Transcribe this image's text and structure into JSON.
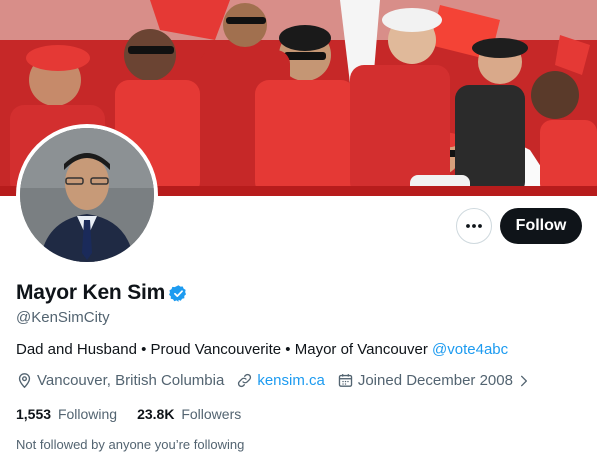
{
  "profile": {
    "display_name": "Mayor Ken Sim",
    "handle": "@KenSimCity",
    "bio_text": "Dad and Husband • Proud Vancouverite • Mayor of Vancouver",
    "bio_mention": "@vote4abc",
    "location": "Vancouver, British Columbia",
    "website": "kensim.ca",
    "joined": "Joined December 2008",
    "following_count": "1,553",
    "following_label": "Following",
    "followers_count": "23.8K",
    "followers_label": "Followers",
    "followed_by_note": "Not followed by anyone you’re following"
  },
  "actions": {
    "follow_label": "Follow",
    "more_icon": "more-horizontal-icon"
  },
  "colors": {
    "accent": "#1d9bf0",
    "text": "#0f1419",
    "secondary": "#536471",
    "banner_red": "#d32f2f"
  },
  "icons": {
    "verified": "verified-badge-icon",
    "location": "location-pin-icon",
    "link": "link-icon",
    "calendar": "calendar-icon",
    "chevron": "chevron-right-icon"
  }
}
